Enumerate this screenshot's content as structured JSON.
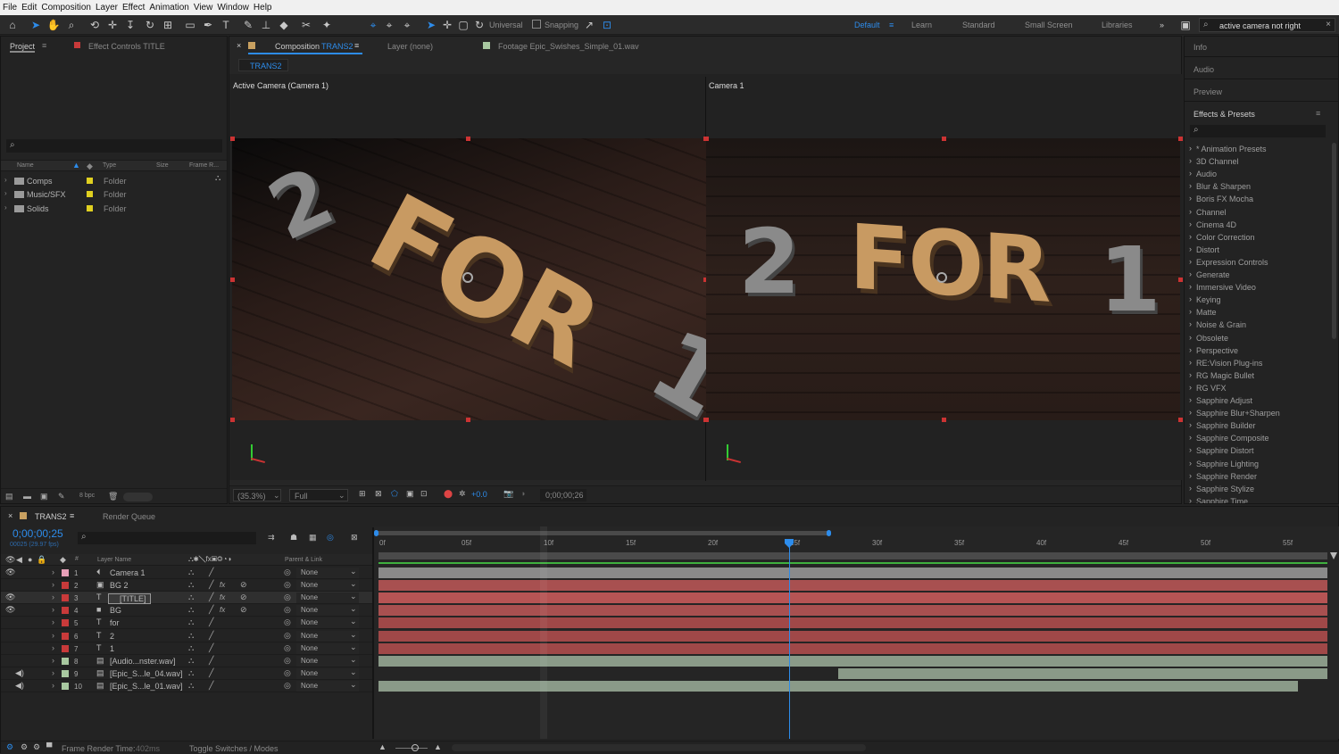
{
  "menu": [
    "File",
    "Edit",
    "Composition",
    "Layer",
    "Effect",
    "Animation",
    "View",
    "Window",
    "Help"
  ],
  "toolbar": {
    "universal": "Universal",
    "snapping": "Snapping",
    "workspaces": [
      "Default",
      "Learn",
      "Standard",
      "Small Screen",
      "Libraries"
    ],
    "search_value": "active camera not right"
  },
  "project": {
    "tab": "Project",
    "effect_controls": "Effect Controls TITLE",
    "columns": [
      "Name",
      "Type",
      "Size",
      "Frame R..."
    ],
    "items": [
      {
        "name": "Comps",
        "type": "Folder"
      },
      {
        "name": "Music/SFX",
        "type": "Folder"
      },
      {
        "name": "Solids",
        "type": "Folder"
      }
    ],
    "bpc": "8 bpc"
  },
  "comp": {
    "tab_prefix": "Composition",
    "tab_name": "TRANS2",
    "layer_tab": "Layer (none)",
    "footage_tab": "Footage Epic_Swishes_Simple_01.wav",
    "breadcrumb": "TRANS2",
    "view_left": "Active Camera (Camera 1)",
    "view_right": "Camera 1",
    "zoom": "(35.3%)",
    "resolution": "Full",
    "exposure": "+0.0",
    "timecode": "0;00;00;26"
  },
  "scene": {
    "left_word1": "2",
    "left_word2": "FOR",
    "left_word3": "1",
    "right_word1": "2",
    "right_word2": "FOR",
    "right_word3": "1"
  },
  "right_panel": {
    "info": "Info",
    "audio": "Audio",
    "preview": "Preview",
    "effects": "Effects & Presets",
    "list": [
      "* Animation Presets",
      "3D Channel",
      "Audio",
      "Blur & Sharpen",
      "Boris FX Mocha",
      "Channel",
      "Cinema 4D",
      "Color Correction",
      "Distort",
      "Expression Controls",
      "Generate",
      "Immersive Video",
      "Keying",
      "Matte",
      "Noise & Grain",
      "Obsolete",
      "Perspective",
      "RE:Vision Plug-ins",
      "RG Magic Bullet",
      "RG VFX",
      "Sapphire Adjust",
      "Sapphire Blur+Sharpen",
      "Sapphire Builder",
      "Sapphire Composite",
      "Sapphire Distort",
      "Sapphire Lighting",
      "Sapphire Render",
      "Sapphire Stylize",
      "Sapphire Time"
    ]
  },
  "timeline": {
    "tab": "TRANS2",
    "render_queue": "Render Queue",
    "timecode": "0;00;00;25",
    "fps": "00025 (29.97 fps)",
    "col_layer": "Layer Name",
    "col_parent": "Parent & Link",
    "ruler": [
      "0f",
      "05f",
      "10f",
      "15f",
      "20f",
      "25f",
      "30f",
      "35f",
      "40f",
      "45f",
      "50f",
      "55f"
    ],
    "layers": [
      {
        "n": "1",
        "name": "Camera 1",
        "parent": "None",
        "color": "#e8a0b8"
      },
      {
        "n": "2",
        "name": "BG 2",
        "parent": "None",
        "color": "#c83a3a"
      },
      {
        "n": "3",
        "name": "[TITLE]",
        "parent": "None",
        "color": "#c83a3a"
      },
      {
        "n": "4",
        "name": "BG",
        "parent": "None",
        "color": "#c83a3a"
      },
      {
        "n": "5",
        "name": "for",
        "parent": "None",
        "color": "#c83a3a"
      },
      {
        "n": "6",
        "name": "2",
        "parent": "None",
        "color": "#c83a3a"
      },
      {
        "n": "7",
        "name": "1",
        "parent": "None",
        "color": "#c83a3a"
      },
      {
        "n": "8",
        "name": "[Audio...nster.wav]",
        "parent": "None",
        "color": "#a8c8a0"
      },
      {
        "n": "9",
        "name": "[Epic_S...le_04.wav]",
        "parent": "None",
        "color": "#a8c8a0"
      },
      {
        "n": "10",
        "name": "[Epic_S...le_01.wav]",
        "parent": "None",
        "color": "#a8c8a0"
      }
    ],
    "footer_render": "Frame Render Time:",
    "footer_render_val": "402ms",
    "footer_toggle": "Toggle Switches / Modes"
  }
}
